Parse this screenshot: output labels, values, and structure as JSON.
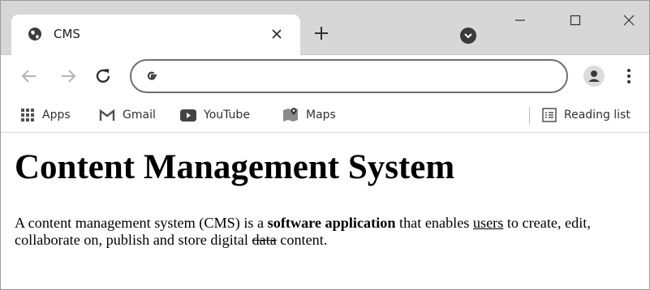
{
  "browser": {
    "tab": {
      "title": "CMS",
      "favicon": "globe-icon"
    },
    "address_bar": {
      "value": "",
      "placeholder": "",
      "icon": "google-g-icon"
    },
    "bookmarks": [
      {
        "label": "Apps",
        "icon": "apps-grid-icon"
      },
      {
        "label": "Gmail",
        "icon": "gmail-icon"
      },
      {
        "label": "YouTube",
        "icon": "youtube-icon"
      },
      {
        "label": "Maps",
        "icon": "maps-icon"
      }
    ],
    "reading_list": {
      "label": "Reading list",
      "icon": "reading-list-icon"
    }
  },
  "page": {
    "heading": "Content Management System",
    "paragraph": {
      "part1": "A content management system (CMS) is a ",
      "bold": "software application",
      "part2": " that enables ",
      "underlined": "users",
      "part3": " to create, edit, collaborate on, publish and store digital ",
      "strikethrough": "data",
      "part4": " content."
    }
  },
  "colors": {
    "tabstrip_bg": "#d7d7d7",
    "page_bg": "#ffffff",
    "icon_gray": "#5f5f5f",
    "text": "#000000"
  }
}
